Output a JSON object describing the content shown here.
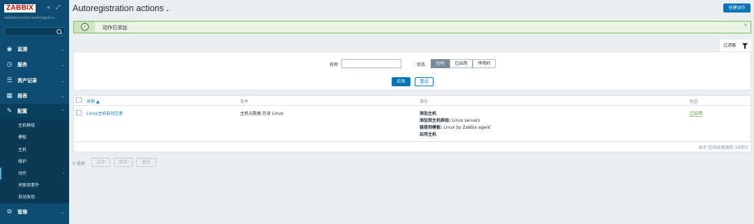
{
  "sidebar": {
    "logo": "ZABBIX",
    "collapse_glyph": "«",
    "kiosk_glyph": "⤢",
    "server_name": "zabbixmaster.walkingclou...",
    "search_placeholder": "",
    "menu": [
      {
        "label": "监测",
        "icon": "eye-icon"
      },
      {
        "label": "服务",
        "icon": "clock-icon"
      },
      {
        "label": "资产记录",
        "icon": "list-icon"
      },
      {
        "label": "报表",
        "icon": "bar-chart-icon"
      },
      {
        "label": "配置",
        "icon": "wrench-icon"
      },
      {
        "label": "管理",
        "icon": "gear-icon"
      }
    ],
    "submenu": [
      "主机群组",
      "模板",
      "主机",
      "维护",
      "动作",
      "关联项事件",
      "自动发现"
    ]
  },
  "header": {
    "title": "Autoregistration actions",
    "create_button": "创建动作"
  },
  "message": {
    "text": "动作已添加",
    "type": "success",
    "close": "×"
  },
  "filter": {
    "tab_label": "过滤器",
    "name_label": "名称",
    "name_value": "",
    "status_label": "状态",
    "status_options": [
      "任何",
      "已启用",
      "停用的"
    ],
    "status_selected": "任何",
    "apply_label": "应用",
    "reset_label": "重设"
  },
  "table": {
    "columns": [
      "名称 ▲",
      "条件",
      "操作",
      "状态"
    ],
    "rows": [
      {
        "name": "Linux主机自动注册",
        "condition": "主机元数据 包含 Linux",
        "operations": [
          {
            "bold": "添加主机",
            "rest": ""
          },
          {
            "bold": "添加到主机群组:",
            "rest": " Linux servers"
          },
          {
            "bold": "链接到模板:",
            "rest": " Linux by Zabbix agent"
          },
          {
            "bold": "启用主机",
            "rest": ""
          }
        ],
        "status": "已启用"
      }
    ],
    "footer": "显示 已自动发现的 1中的1"
  },
  "mass_actions": {
    "selected": "0 选择",
    "enable": "启用",
    "disable": "禁用",
    "delete": "删除"
  },
  "colors": {
    "sidebar_bg": "#0e4d72",
    "accent": "#0275b8",
    "success_green": "#429e1f",
    "message_border": "#7bbd5e"
  }
}
